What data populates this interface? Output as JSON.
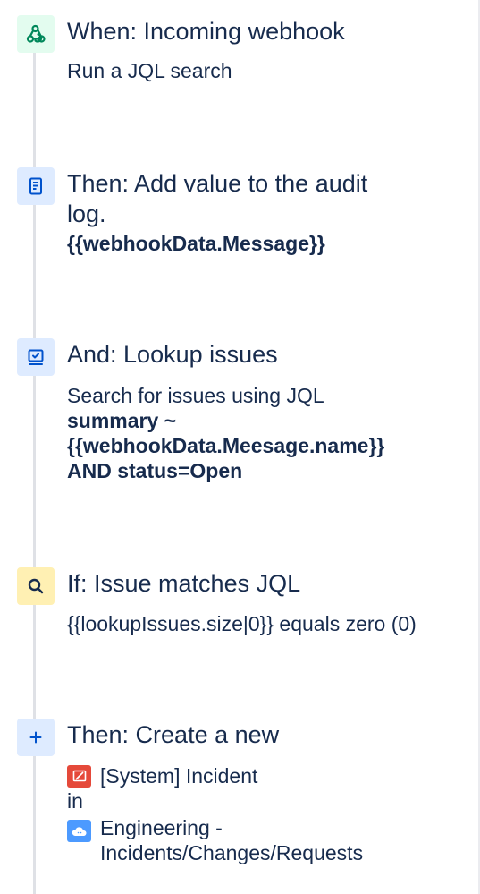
{
  "steps": [
    {
      "title": "When: Incoming webhook",
      "icon": "webhook-icon",
      "body": [
        "Run a JQL search"
      ]
    },
    {
      "title": "Then: Add value to the audit log.",
      "icon": "audit-log-icon",
      "value": "{{webhookData.Message}}"
    },
    {
      "title": "And: Lookup issues",
      "icon": "lookup-issues-icon",
      "body_text": "Search for issues using JQL",
      "jql_lines": [
        "summary ~",
        "{{webhookData.Meesage.name}}",
        "AND status=Open"
      ]
    },
    {
      "title": "If: Issue matches JQL",
      "icon": "search-icon",
      "condition": "{{lookupIssues.size|0}} equals zero (0)"
    },
    {
      "title": "Then: Create a new",
      "icon": "plus-icon",
      "issue_type": "[System] Incident",
      "in_text": "in",
      "project": "Engineering - Incidents/Changes/Requests"
    }
  ],
  "colors": {
    "text": "#172b4d",
    "rail": "#dfe1e6",
    "trigger_bg": "#e3fcef",
    "trigger_icon": "#00875a",
    "action_bg": "#deebff",
    "action_icon": "#0052cc",
    "condition_bg": "#fff0b3",
    "condition_icon": "#172b4d",
    "incident_red": "#e5493a"
  }
}
